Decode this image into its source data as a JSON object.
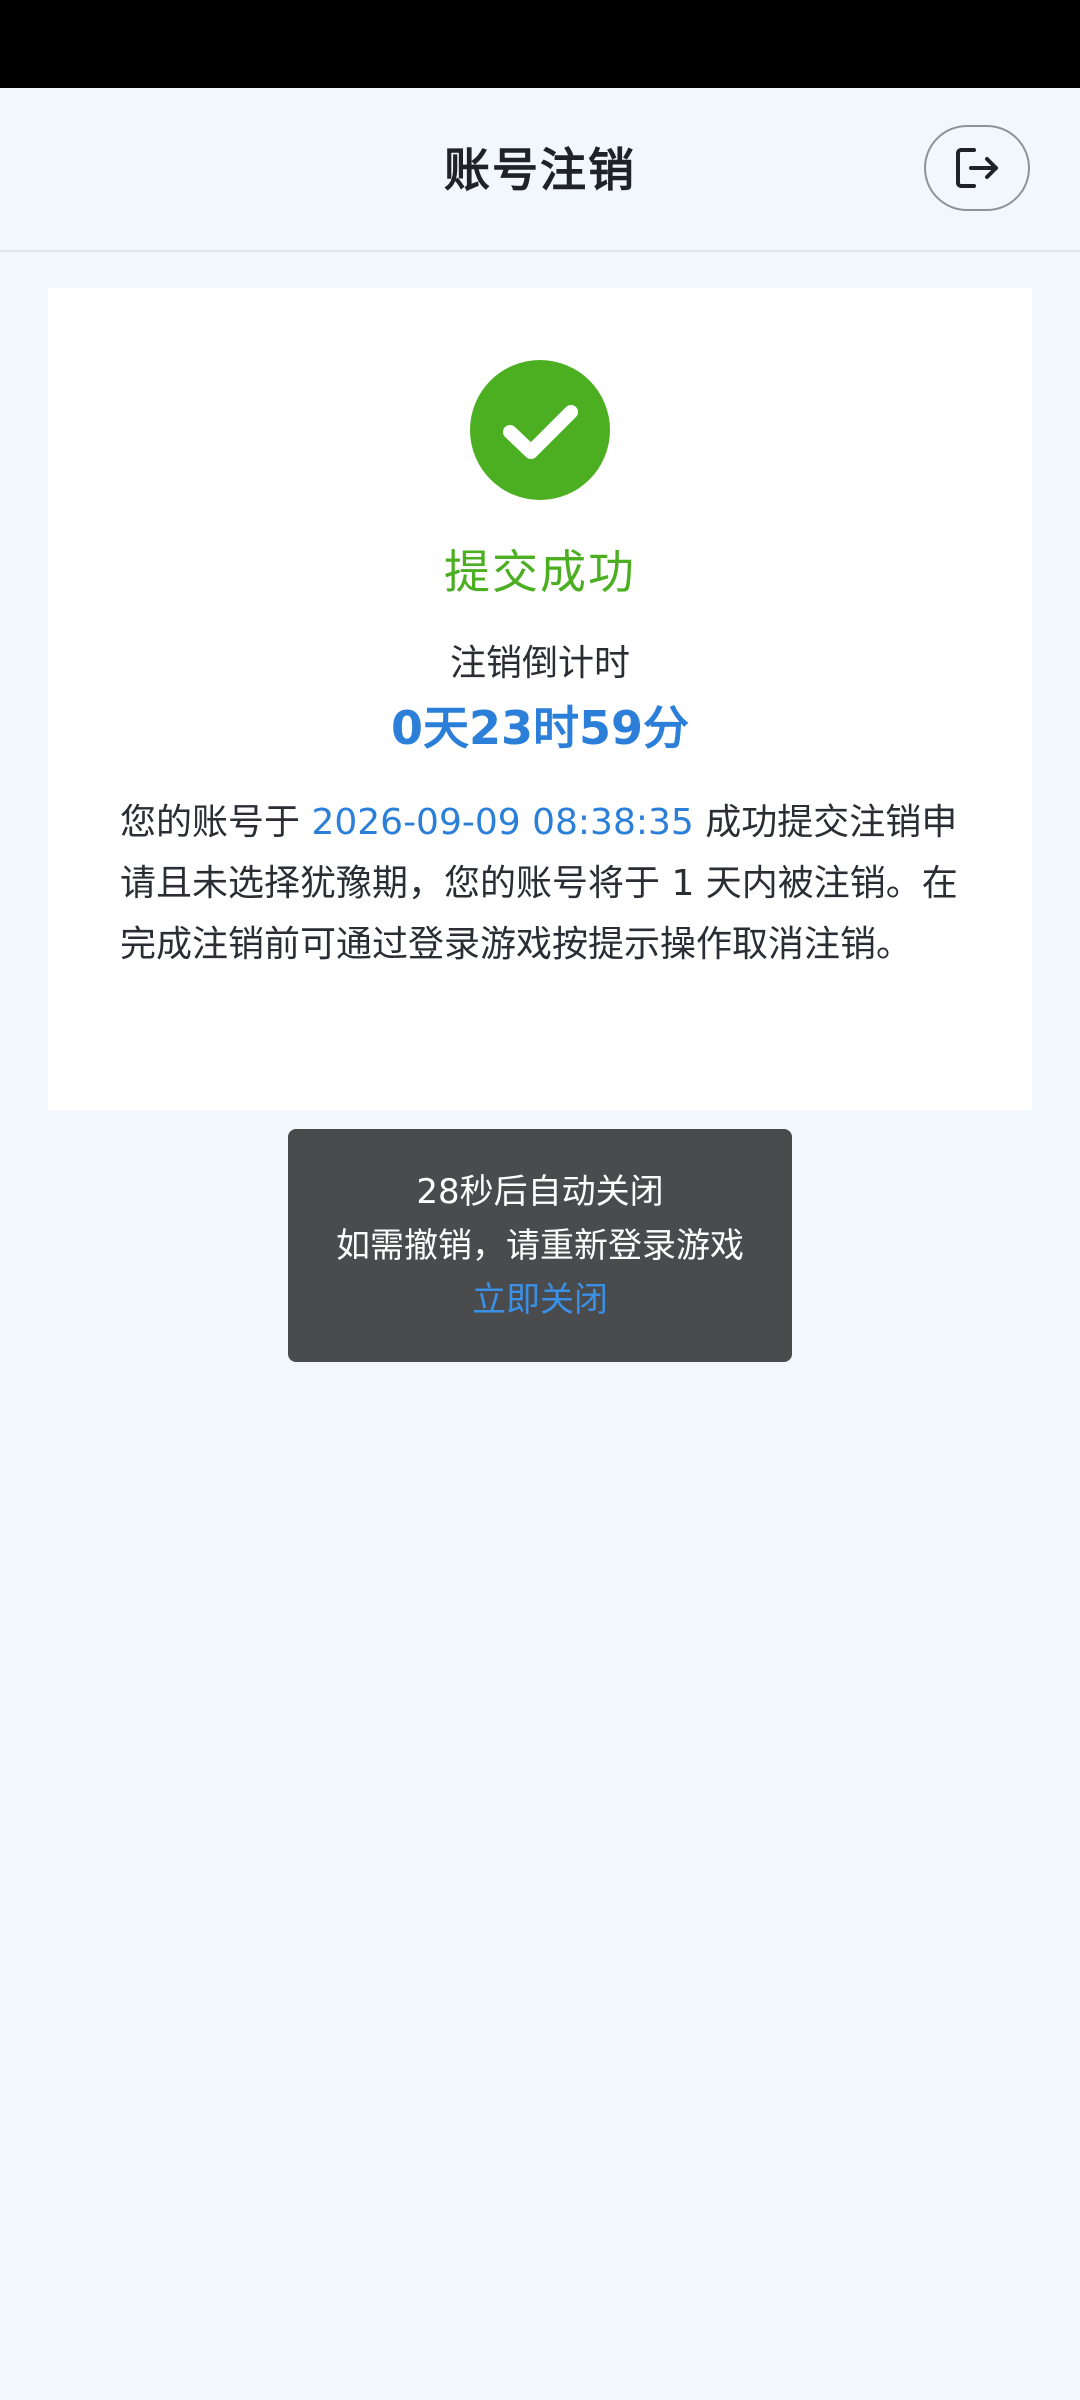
{
  "header": {
    "title": "账号注销",
    "exit_icon": "logout-icon"
  },
  "result": {
    "icon": "check-circle-icon",
    "icon_color": "#4caf22",
    "title": "提交成功",
    "countdown_label": "注销倒计时",
    "countdown_value": "0天23时59分"
  },
  "description": {
    "prefix": "您的账号于 ",
    "timestamp": "2026-09-09 08:38:35",
    "suffix": " 成功提交注销申请且未选择犹豫期，您的账号将于 1 天内被注销。在完成注销前可通过登录游戏按提示操作取消注销。"
  },
  "toast": {
    "auto_close": "28秒后自动关闭",
    "hint": "如需撤销，请重新登录游戏",
    "close_label": "立即关闭"
  },
  "colors": {
    "accent_blue": "#2b7fd8",
    "success_green": "#4caf22",
    "background": "#f2f7fd"
  }
}
